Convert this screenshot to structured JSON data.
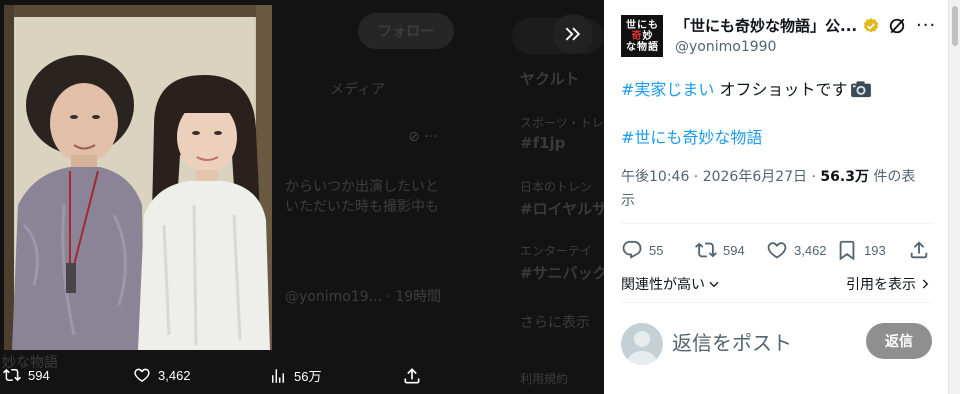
{
  "background_timeline": {
    "follow_label": "フォロー",
    "tab_media": "メディア",
    "trend_heading": "ヤクルト",
    "trend_1_category": "スポーツ・トレ",
    "trend_1_tag": "#f1jp",
    "trend_2_category": "日本のトレン",
    "trend_2_tag": "#ロイヤルサ",
    "trend_3_category": "エンターテイ",
    "trend_3_tag": "#サニバック",
    "show_more": "さらに表示",
    "post_text_1": "からいつか出演したいと",
    "post_text_2": "いただいた時も撮影中も",
    "post_meta": "@yonimo19... · 19時間",
    "post_footer": "妙な物語",
    "footer_small": "利用規約"
  },
  "media_actions": {
    "retweets": "594",
    "likes": "3,462",
    "views": "56万"
  },
  "post": {
    "avatar_text": [
      "世",
      "に",
      "も",
      "奇",
      "妙",
      "な",
      "物",
      "語"
    ],
    "display_name": "「世にも奇妙な物語」公...",
    "handle": "@yonimo1990",
    "line1_hashtag": "#実家じまい",
    "line1_text": " オフショットです",
    "line2_hashtag": "#世にも奇妙な物語",
    "time_date": "午後10:46 · 2026年6月27日 · ",
    "views_count": "56.3万",
    "views_suffix": " 件の表示",
    "replies": "55",
    "retweets": "594",
    "likes": "3,462",
    "bookmarks": "193",
    "sort_label": "関連性が高い",
    "quotes_label": "引用を表示",
    "reply_placeholder": "返信をポスト",
    "reply_button": "返信"
  },
  "colors": {
    "accent": "#1d9bf0",
    "verified_gold": "#e2b719",
    "secondary_text": "#536471"
  }
}
